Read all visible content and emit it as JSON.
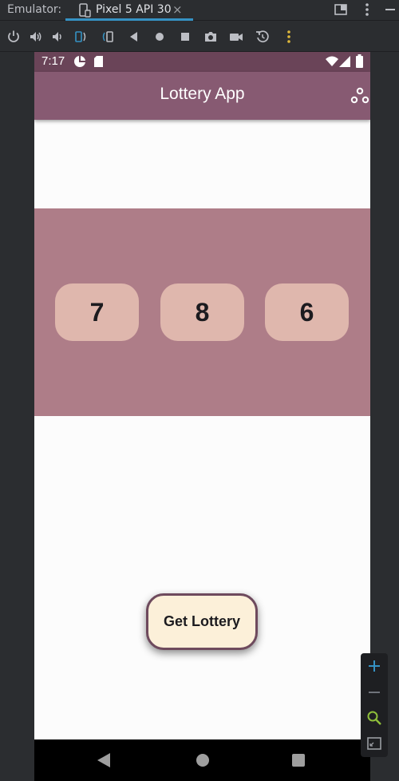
{
  "emulator": {
    "label": "Emulator:",
    "tab_label": "Pixel 5 API 30",
    "tab_close": "×"
  },
  "toolbar": {
    "icons": [
      "power-icon",
      "volume-up-icon",
      "volume-down-icon",
      "rotate-left-icon",
      "rotate-right-icon",
      "back-icon",
      "home-icon",
      "overview-icon",
      "screenshot-icon",
      "screen-record-icon",
      "snapshot-icon",
      "more-icon"
    ]
  },
  "statusbar": {
    "time": "7:17"
  },
  "appbar": {
    "title": "Lottery App"
  },
  "lottery": {
    "numbers": [
      "7",
      "8",
      "6"
    ]
  },
  "actions": {
    "get_lottery": "Get Lottery"
  },
  "colors": {
    "appbar": "#875a72",
    "statusbar": "#6a4458",
    "panel": "#ae7d88",
    "number_box": "#dfb7ad",
    "button": "#fcf0d9",
    "accent": "#3592c4"
  }
}
